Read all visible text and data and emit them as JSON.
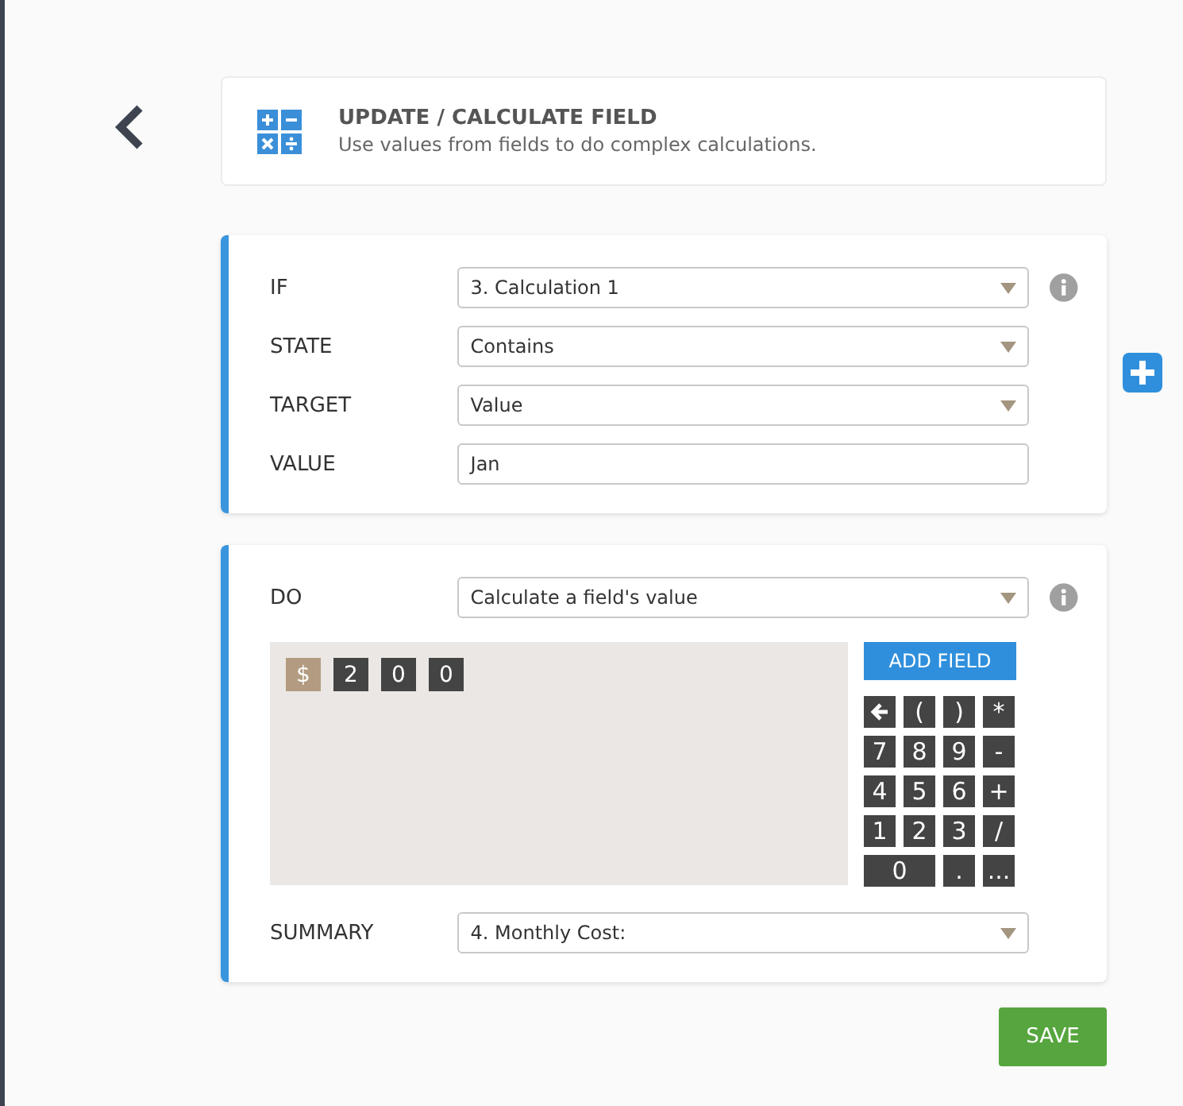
{
  "header": {
    "title": "UPDATE / CALCULATE FIELD",
    "subtitle": "Use values from fields to do complex calculations."
  },
  "condition": {
    "rows": [
      {
        "label": "IF",
        "kind": "select",
        "value": "3. Calculation 1",
        "info": true
      },
      {
        "label": "STATE",
        "kind": "select",
        "value": "Contains",
        "info": false
      },
      {
        "label": "TARGET",
        "kind": "select",
        "value": "Value",
        "info": false
      },
      {
        "label": "VALUE",
        "kind": "text",
        "value": "Jan",
        "info": false
      }
    ]
  },
  "action": {
    "do": {
      "label": "DO",
      "value": "Calculate a field's value",
      "info": true
    },
    "formula": [
      {
        "text": "$",
        "kind": "symbol"
      },
      {
        "text": "2",
        "kind": "number"
      },
      {
        "text": "0",
        "kind": "number"
      },
      {
        "text": "0",
        "kind": "number"
      }
    ],
    "add_field": "ADD FIELD",
    "keys": [
      {
        "kind": "backspace",
        "wide": false
      },
      {
        "kind": "text",
        "text": "(",
        "wide": false
      },
      {
        "kind": "text",
        "text": ")",
        "wide": false
      },
      {
        "kind": "text",
        "text": "*",
        "wide": false
      },
      {
        "kind": "text",
        "text": "7",
        "wide": false
      },
      {
        "kind": "text",
        "text": "8",
        "wide": false
      },
      {
        "kind": "text",
        "text": "9",
        "wide": false
      },
      {
        "kind": "text",
        "text": "-",
        "wide": false
      },
      {
        "kind": "text",
        "text": "4",
        "wide": false
      },
      {
        "kind": "text",
        "text": "5",
        "wide": false
      },
      {
        "kind": "text",
        "text": "6",
        "wide": false
      },
      {
        "kind": "text",
        "text": "+",
        "wide": false
      },
      {
        "kind": "text",
        "text": "1",
        "wide": false
      },
      {
        "kind": "text",
        "text": "2",
        "wide": false
      },
      {
        "kind": "text",
        "text": "3",
        "wide": false
      },
      {
        "kind": "text",
        "text": "/",
        "wide": false
      },
      {
        "kind": "text",
        "text": "0",
        "wide": true
      },
      {
        "kind": "text",
        "text": ".",
        "wide": false
      },
      {
        "kind": "text",
        "text": "...",
        "wide": false
      }
    ],
    "summary": {
      "label": "SUMMARY",
      "value": "4. Monthly Cost:"
    }
  },
  "save": "SAVE"
}
